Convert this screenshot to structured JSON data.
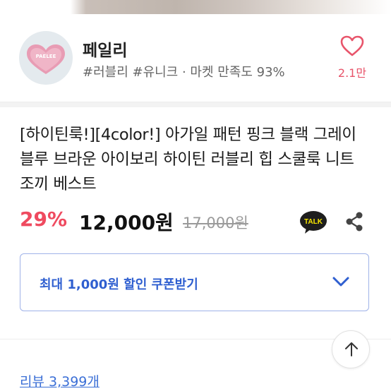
{
  "shop": {
    "name": "페일리",
    "tags": "#러블리 #유니크 · 마켓 만족도 93%",
    "logo_text": "PAELEE",
    "like_count": "2.1만"
  },
  "product": {
    "title": "[하이틴룩!][4color!] 아가일 패턴 핑크 블랙 그레이 블루 브라운 아이보리 하이틴 러블리 힙 스쿨룩 니트 조끼 베스트",
    "discount": "29%",
    "price": "12,000원",
    "original_price": "17,000원"
  },
  "icons": {
    "talk": "kakao-talk-icon",
    "talk_text": "TALK",
    "share": "share-icon",
    "like": "heart-icon",
    "coupon_expand": "chevron-down-icon",
    "scroll_top": "arrow-up-icon"
  },
  "coupon": {
    "label": "최대 1,000원 할인 쿠폰받기"
  },
  "review": {
    "label": "리뷰 3,399개"
  },
  "colors": {
    "accent_red": "#ef4a5f",
    "heart_pink": "#e8556b",
    "coupon_blue": "#2f5fd0",
    "link_blue": "#3b6fd6"
  }
}
